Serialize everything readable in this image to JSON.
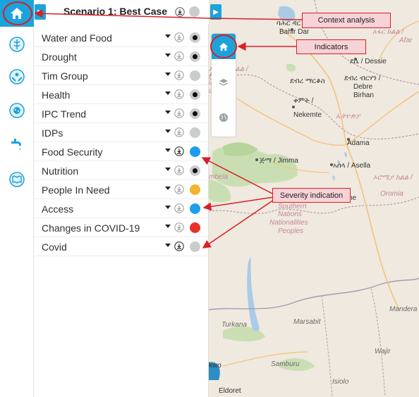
{
  "panel": {
    "scenario_title": "Scenario 1: Best Case",
    "items": [
      {
        "label": "Water and Food",
        "dot": "#c9cdcb",
        "inner": true
      },
      {
        "label": "Drought",
        "dot": "#c9cdcb",
        "inner": true
      },
      {
        "label": "Tim Group",
        "dot": "#c9cdcb",
        "inner": false
      },
      {
        "label": "Health",
        "dot": "#c9cdcb",
        "inner": true
      },
      {
        "label": "IPC Trend",
        "dot": "#c9cdcb",
        "inner": true
      },
      {
        "label": "IDPs",
        "dot": "#c9cdcb",
        "inner": false
      },
      {
        "label": "Food Security",
        "dot": "#1c9df0",
        "inner": false
      },
      {
        "label": "Nutrition",
        "dot": "#c9cdcb",
        "inner": true
      },
      {
        "label": "People In Need",
        "dot": "#f1b42a",
        "inner": false
      },
      {
        "label": "Access",
        "dot": "#1c9df0",
        "inner": false
      },
      {
        "label": "Changes in COVID-19",
        "dot": "#e63028",
        "inner": false
      },
      {
        "label": "Covid",
        "dot": "#c9cdcb",
        "inner": false
      }
    ]
  },
  "rail": {
    "items": [
      "home-icon",
      "medical-icon",
      "hands-icon",
      "virus-icon",
      "water-tap-icon",
      "book-icon"
    ]
  },
  "map": {
    "labels": [
      {
        "text": "ባሕር ዳር",
        "cls": ""
      },
      {
        "text": "Bahir Dar",
        "cls": ""
      },
      {
        "text": "አፋር ክልል /",
        "cls": "region"
      },
      {
        "text": "Afar",
        "cls": "region"
      },
      {
        "text": "ደሴ / Dessie",
        "cls": ""
      },
      {
        "text": "ደብረ ብርሃን /",
        "cls": ""
      },
      {
        "text": "Debre",
        "cls": ""
      },
      {
        "text": "Birhan",
        "cls": ""
      },
      {
        "text": "ደብረ ማርቆስ",
        "cls": ""
      },
      {
        "text": "ኦሮሚያ ክልል /",
        "cls": "region"
      },
      {
        "text": "Oromia",
        "cls": "region"
      },
      {
        "text": "ቀምት /",
        "cls": ""
      },
      {
        "text": "Nekemte",
        "cls": ""
      },
      {
        "text": "ኢትዮጵያ",
        "cls": "region"
      },
      {
        "text": "Adama",
        "cls": ""
      },
      {
        "text": "ጅማ / Jimma",
        "cls": ""
      },
      {
        "text": "አሰላ / Asella",
        "cls": ""
      },
      {
        "text": "ኦሮሚያ ክልል /",
        "cls": "region"
      },
      {
        "text": "Oromia",
        "cls": "region"
      },
      {
        "text": "mbela",
        "cls": "region"
      },
      {
        "text": "Southern",
        "cls": "region"
      },
      {
        "text": "Nations",
        "cls": "region"
      },
      {
        "text": "Nationalities",
        "cls": "region"
      },
      {
        "text": "Peoples",
        "cls": "region"
      },
      {
        "text": "Turkana",
        "cls": "park"
      },
      {
        "text": "Marsabit",
        "cls": "park"
      },
      {
        "text": "Mandera",
        "cls": "park"
      },
      {
        "text": "Wajir",
        "cls": "park"
      },
      {
        "text": "Samburu",
        "cls": "park"
      },
      {
        "text": "Isiolo",
        "cls": "park"
      },
      {
        "text": "kwo",
        "cls": ""
      },
      {
        "text": "Eldoret",
        "cls": ""
      },
      {
        "text": "ungul-",
        "cls": "region"
      },
      {
        "text": "uz",
        "cls": "region"
      },
      {
        "text": "ልል /",
        "cls": "region"
      },
      {
        "text": "he",
        "cls": ""
      }
    ]
  },
  "annotations": {
    "context_analysis": "Context analysis",
    "indicators": "Indicators",
    "severity": "Severity indication"
  },
  "colors": {
    "accent": "#1ba3dc",
    "annotation": "#d81f26"
  }
}
